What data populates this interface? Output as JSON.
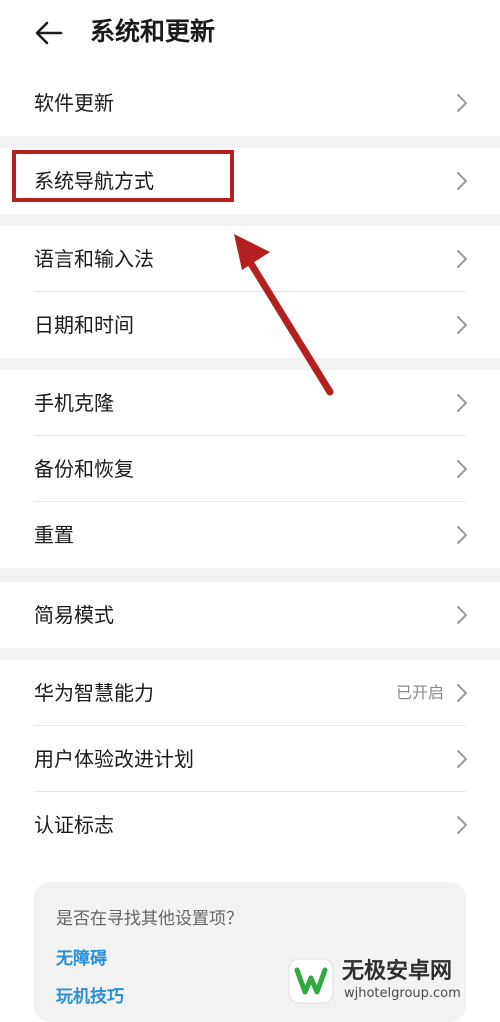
{
  "header": {
    "title": "系统和更新"
  },
  "groups": [
    {
      "items": [
        {
          "label": "软件更新"
        }
      ]
    },
    {
      "items": [
        {
          "label": "系统导航方式"
        }
      ]
    },
    {
      "items": [
        {
          "label": "语言和输入法"
        },
        {
          "label": "日期和时间"
        }
      ]
    },
    {
      "items": [
        {
          "label": "手机克隆"
        },
        {
          "label": "备份和恢复"
        },
        {
          "label": "重置"
        }
      ]
    },
    {
      "items": [
        {
          "label": "简易模式"
        }
      ]
    },
    {
      "items": [
        {
          "label": "华为智慧能力",
          "value": "已开启"
        },
        {
          "label": "用户体验改进计划"
        },
        {
          "label": "认证标志"
        }
      ]
    }
  ],
  "suggest": {
    "title": "是否在寻找其他设置项？",
    "links": [
      "无障碍",
      "玩机技巧"
    ]
  },
  "annotation": {
    "color": "#b41f1f"
  },
  "watermark": {
    "name": "无极安卓网",
    "url": "wjhotelgroup.com"
  },
  "colors": {
    "link": "#2a8fd6",
    "separator": "#f2f2f2"
  }
}
